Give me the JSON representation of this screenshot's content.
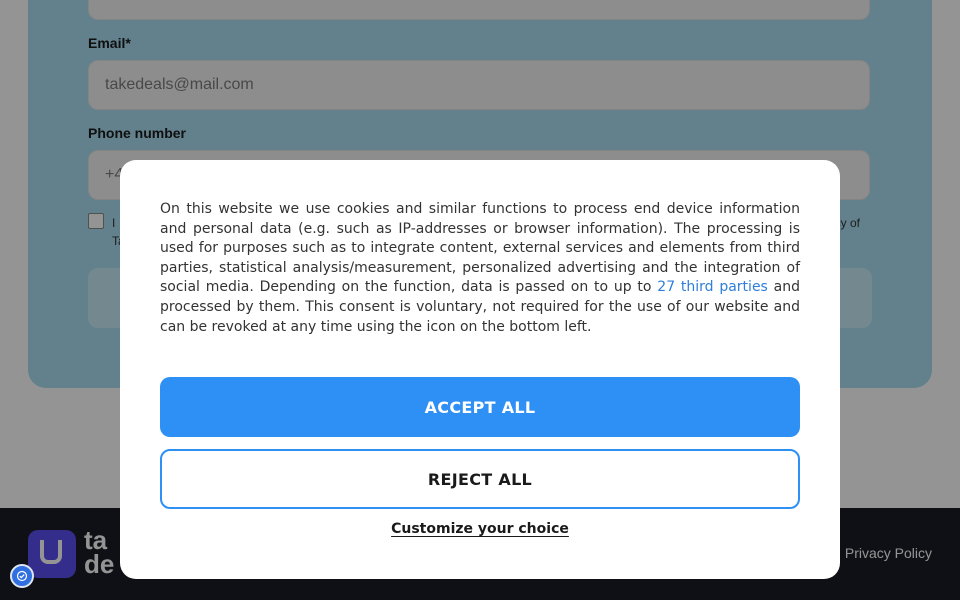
{
  "form": {
    "email_label": "Email*",
    "email_placeholder": "takedeals@mail.com",
    "phone_label": "Phone number",
    "phone_value": "+4",
    "consent_left": "I",
    "consent_left_line2": "Ta",
    "consent_right": "icy of"
  },
  "footer": {
    "wordmark_line1": "ta",
    "wordmark_line2": "de",
    "privacy_link": "Privacy Policy"
  },
  "cookie_modal": {
    "text_before_link": "On this website we use cookies and similar functions to process end device information and personal data (e.g. such as IP-addresses or browser information). The processing is used for purposes such as to integrate content, external services and elements from third parties, statistical analysis/measurement, personalized advertising and the integration of social media. Depending on the function, data is passed on to up to ",
    "third_parties_link": "27 third parties",
    "text_after_link": " and processed by them. This consent is voluntary, not required for the use of our website and can be revoked at any time using the icon on the bottom left.",
    "accept_label": "ACCEPT ALL",
    "reject_label": "REJECT ALL",
    "customize_label": "Customize your choice"
  },
  "colors": {
    "accent": "#2e8ff5",
    "form_card": "#a9dff2",
    "footer_bg": "#1b1d26"
  },
  "icons": {
    "consent_settings": "cookie-settings-icon",
    "logo": "takedeals-logo-icon"
  }
}
